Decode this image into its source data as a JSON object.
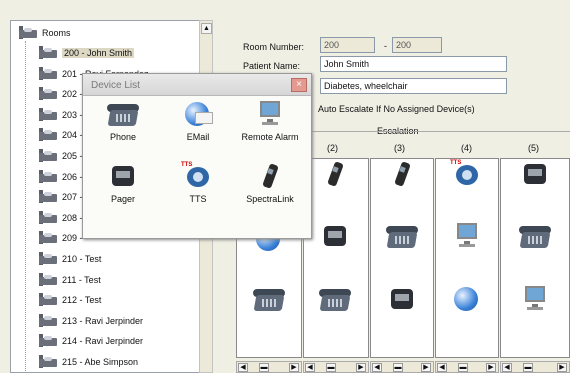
{
  "tree": {
    "root_label": "Rooms",
    "rooms": [
      "200 - John Smith",
      "201 - Ravi Fernandez",
      "202 -",
      "203 -",
      "204 -",
      "205 -",
      "206 -",
      "207 -",
      "208 -",
      "209 -",
      "210 - Test",
      "211 - Test",
      "212 - Test",
      "213 - Ravi Jerpinder",
      "214 - Ravi Jerpinder",
      "215 - Abe Simpson"
    ],
    "selected_index": 0
  },
  "form": {
    "room_number_label": "Room Number:",
    "room_from": "200",
    "room_dash": "-",
    "room_to": "200",
    "patient_name_label": "Patient Name:",
    "patient_name": "John Smith",
    "notes": "Diabetes, wheelchair",
    "auto_escalate_label": "Auto Escalate If No Assigned Device(s)"
  },
  "escalation": {
    "title": "Escalation",
    "columns": [
      "(2)",
      "(3)",
      "(4)",
      "(5)"
    ]
  },
  "popup": {
    "title": "Device List",
    "close_label": "×",
    "items": [
      {
        "label": "Phone",
        "icon": "phone-icon"
      },
      {
        "label": "EMail",
        "icon": "email-icon"
      },
      {
        "label": "Remote Alarm",
        "icon": "remote-alarm-icon"
      },
      {
        "label": "Pager",
        "icon": "pager-icon"
      },
      {
        "label": "TTS",
        "icon": "tts-icon"
      },
      {
        "label": "SpectraLink",
        "icon": "spectralink-icon"
      }
    ]
  },
  "icons": {
    "tts_badge": "TTS"
  },
  "colors": {
    "background": "#f0efe4",
    "popup_close": "#e49a90"
  }
}
